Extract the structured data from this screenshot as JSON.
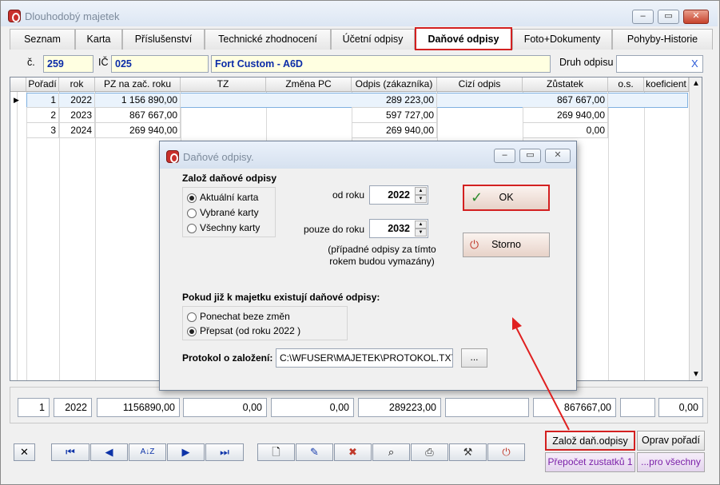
{
  "window": {
    "title": "Dlouhodobý majetek"
  },
  "tabs": [
    {
      "label": "Seznam"
    },
    {
      "label": "Karta"
    },
    {
      "label": "Příslušenství"
    },
    {
      "label": "Technické zhodnocení"
    },
    {
      "label": "Účetní odpisy"
    },
    {
      "label": "Daňové odpisy"
    },
    {
      "label": "Foto+Dokumenty"
    },
    {
      "label": "Pohyby-Historie"
    }
  ],
  "header": {
    "c_label": "č.",
    "c_value": "259",
    "ic_label": "IČ",
    "ic_value": "025",
    "name_value": "Fort Custom - A6D",
    "druh_label": "Druh odpisu",
    "druh_value": "",
    "clear_glyph": "X"
  },
  "table": {
    "columns": [
      "Pořadí",
      "rok",
      "PZ na zač. roku",
      "TZ",
      "Změna PC",
      "Odpis (zákazníka)",
      "Cizí odpis",
      "Zůstatek",
      "o.s.",
      "koeficient"
    ],
    "rows": [
      {
        "poradi": "1",
        "rok": "2022",
        "pz": "1 156 890,00",
        "odpis": "289 223,00",
        "zustatek": "867 667,00"
      },
      {
        "poradi": "2",
        "rok": "2023",
        "pz": "867 667,00",
        "odpis": "597 727,00",
        "zustatek": "269 940,00"
      },
      {
        "poradi": "3",
        "rok": "2024",
        "pz": "269 940,00",
        "odpis": "269 940,00",
        "zustatek": "0,00"
      }
    ]
  },
  "summary": [
    "1",
    "2022",
    "1156890,00",
    "0,00",
    "0,00",
    "289223,00",
    "",
    "867667,00",
    "",
    "0,00"
  ],
  "buttons": {
    "zaloz": "Založ daň.odpisy",
    "oprav": "Oprav pořadí",
    "prepocet": "Přepočet zustatků 1",
    "prov": "...pro všechny"
  },
  "dialog": {
    "title": "Daňové odpisy.",
    "section1": "Založ daňové odpisy",
    "opt_aktualni": "Aktuální karta",
    "opt_vybrane": "Vybrané karty",
    "opt_vsechny": "Všechny karty",
    "od_roku_label": "od roku",
    "od_roku_value": "2022",
    "do_roku_label": "pouze do roku",
    "do_roku_value": "2032",
    "note": "(případné odpisy za tímto rokem budou vymazány)",
    "section2": "Pokud již k majetku existují daňové odpisy:",
    "opt_ponechat": "Ponechat beze změn",
    "opt_prepsat": "Přepsat (od roku 2022 )",
    "protokol_label": "Protokol o založení:",
    "protokol_value": "C:\\WFUSER\\MAJETEK\\PROTOKOL.TXT",
    "browse": "...",
    "ok": "OK",
    "storno": "Storno"
  },
  "colors": {
    "highlight": "#d32020",
    "field_bg": "#ffffe1",
    "field_text": "#0b2ca8"
  }
}
